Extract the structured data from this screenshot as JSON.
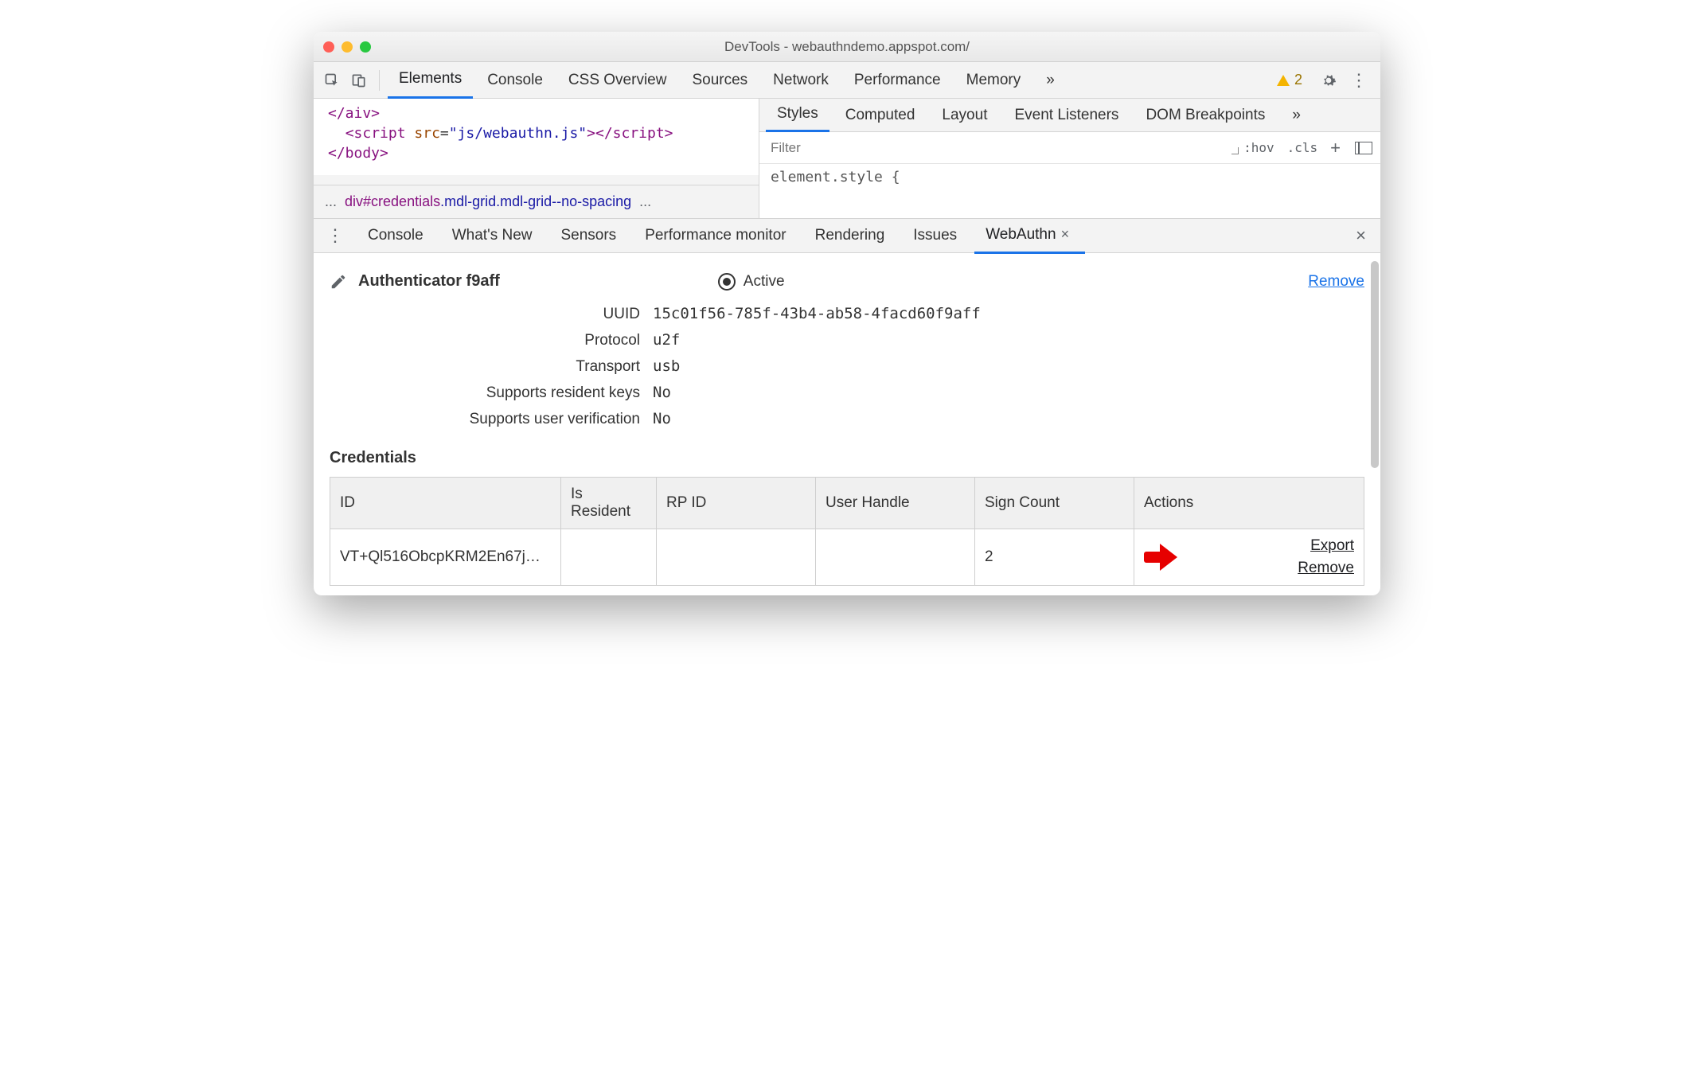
{
  "window": {
    "title": "DevTools - webauthndemo.appspot.com/"
  },
  "main_tabs": {
    "items": [
      "Elements",
      "Console",
      "CSS Overview",
      "Sources",
      "Network",
      "Performance",
      "Memory"
    ],
    "warnings": "2"
  },
  "elements_pane": {
    "code_line1_close": "</aiv>",
    "code_line2_open": "<script ",
    "code_line2_attr": "src",
    "code_line2_val": "\"js/webauthn.js\"",
    "code_line2_close": "></script>",
    "code_line3": "</body>",
    "breadcrumb_dots": "...",
    "breadcrumb_tag": "div#credentials",
    "breadcrumb_cls": ".mdl-grid.mdl-grid--no-spacing",
    "breadcrumb_dots2": "..."
  },
  "styles_pane": {
    "tabs": [
      "Styles",
      "Computed",
      "Layout",
      "Event Listeners",
      "DOM Breakpoints"
    ],
    "filter_placeholder": "Filter",
    "hov": ":hov",
    "cls": ".cls",
    "element_style": "element.style {"
  },
  "drawer": {
    "tabs": [
      "Console",
      "What's New",
      "Sensors",
      "Performance monitor",
      "Rendering",
      "Issues",
      "WebAuthn"
    ]
  },
  "webauthn": {
    "title": "Authenticator f9aff",
    "active_label": "Active",
    "remove_label": "Remove",
    "props": {
      "uuid_label": "UUID",
      "uuid": "15c01f56-785f-43b4-ab58-4facd60f9aff",
      "protocol_label": "Protocol",
      "protocol": "u2f",
      "transport_label": "Transport",
      "transport": "usb",
      "resident_label": "Supports resident keys",
      "resident": "No",
      "userverif_label": "Supports user verification",
      "userverif": "No"
    },
    "credentials_heading": "Credentials",
    "table": {
      "headers": [
        "ID",
        "Is Resident",
        "RP ID",
        "User Handle",
        "Sign Count",
        "Actions"
      ],
      "row": {
        "id": "VT+Ql516ObcpKRM2En67j…",
        "is_resident": "",
        "rp_id": "",
        "user_handle": "",
        "sign_count": "2",
        "export": "Export",
        "remove": "Remove"
      }
    }
  }
}
